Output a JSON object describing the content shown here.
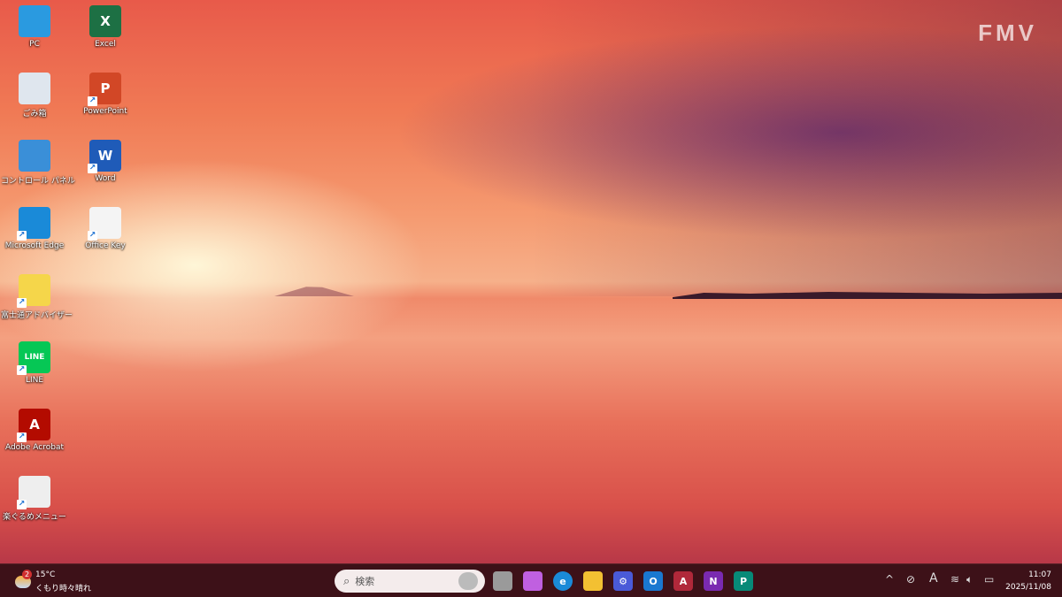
{
  "wallpaper": {
    "logo": "FMV"
  },
  "desktop_icons": [
    {
      "label": "PC",
      "icon": "monitor-icon",
      "color": "#2a9ae0"
    },
    {
      "label": "Excel",
      "icon": "excel-icon",
      "color": "#1d7044",
      "glyph": "X"
    },
    {
      "label": "ごみ箱",
      "icon": "recycle-bin-icon",
      "color": "#dfe6ee"
    },
    {
      "label": "PowerPoint",
      "icon": "powerpoint-icon",
      "color": "#d24726",
      "glyph": "P"
    },
    {
      "label": "コントロール パネル",
      "icon": "control-panel-icon",
      "color": "#3a8fd8"
    },
    {
      "label": "Word",
      "icon": "word-icon",
      "color": "#1f5bb8",
      "glyph": "W"
    },
    {
      "label": "Microsoft Edge",
      "icon": "edge-icon",
      "color": "#1a8ad8"
    },
    {
      "label": "Office Key",
      "icon": "document-icon",
      "color": "#f4f4f4"
    },
    {
      "label": "富士通アドバイザー",
      "icon": "advisor-icon",
      "color": "#f5d64a"
    },
    {
      "label": "LINE",
      "icon": "line-icon",
      "color": "#06c755",
      "glyph": "LINE"
    },
    {
      "label": "Adobe Acrobat",
      "icon": "acrobat-icon",
      "color": "#b30b00",
      "glyph": "A"
    },
    {
      "label": "楽ぐるめメニュー",
      "icon": "menu-icon",
      "color": "#eeeeee"
    }
  ],
  "taskbar": {
    "weather": {
      "badge": "2",
      "temp": "15°C",
      "condition": "くもり時々晴れ"
    },
    "search_placeholder": "検索",
    "apps": [
      {
        "name": "task-view",
        "color": "#9a9a9a",
        "glyph": ""
      },
      {
        "name": "copilot",
        "color": "#c060e0",
        "glyph": ""
      },
      {
        "name": "edge",
        "color": "#1a8ad8",
        "glyph": "e"
      },
      {
        "name": "file-explorer",
        "color": "#f3c032",
        "glyph": ""
      },
      {
        "name": "control-app",
        "color": "#4a5ad8",
        "glyph": "⚙"
      },
      {
        "name": "outlook",
        "color": "#1a78d0",
        "glyph": "O"
      },
      {
        "name": "access",
        "color": "#b0283a",
        "glyph": "A"
      },
      {
        "name": "onenote",
        "color": "#7a2ab0",
        "glyph": "N"
      },
      {
        "name": "publisher",
        "color": "#078a78",
        "glyph": "P"
      }
    ],
    "ime": "A",
    "time": "11:07",
    "date": "2025/11/08"
  }
}
